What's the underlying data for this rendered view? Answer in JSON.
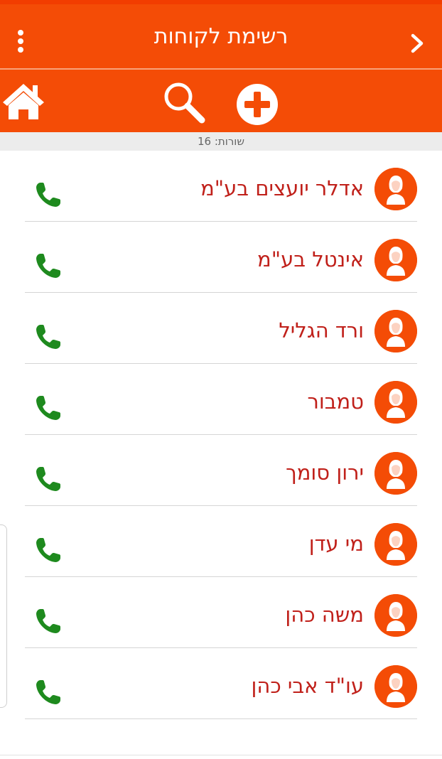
{
  "header": {
    "title": "רשימת לקוחות",
    "menu_icon": "kebab-icon",
    "back_icon": "chevron-right-icon"
  },
  "toolbar": {
    "home_icon": "home-icon",
    "search_icon": "search-icon",
    "add_icon": "add-circle-icon"
  },
  "status": {
    "rows_label": "שורות: 16"
  },
  "colors": {
    "accent": "#f44c06",
    "name_text": "#c0201a",
    "phone": "#1e8a1e"
  },
  "contacts": [
    {
      "name": "אדלר יועצים בע\"מ"
    },
    {
      "name": "אינטל בע\"מ"
    },
    {
      "name": "ורד הגליל"
    },
    {
      "name": "טמבור"
    },
    {
      "name": "ירון סומך"
    },
    {
      "name": "מי עדן"
    },
    {
      "name": "משה כהן"
    },
    {
      "name": "עו\"ד אבי כהן"
    }
  ]
}
